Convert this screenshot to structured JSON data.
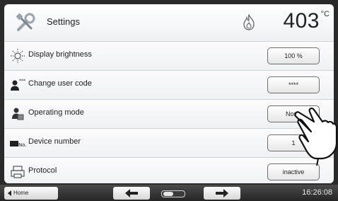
{
  "header": {
    "title": "Settings",
    "title_icon": "tools-icon",
    "temperature": "403",
    "temperature_unit": "°C",
    "status_icon": "flame-icon"
  },
  "rows": [
    {
      "label": "Display brightness",
      "value": "100 %",
      "icon": "sun-icon"
    },
    {
      "label": "Change user code",
      "value": "****",
      "icon": "user-code-icon"
    },
    {
      "label": "Operating mode",
      "value": "Norm",
      "icon": "operating-mode-icon"
    },
    {
      "label": "Device number",
      "value": "1",
      "icon": "device-number-icon"
    },
    {
      "label": "Protocol",
      "value": "inactive",
      "icon": "printer-icon"
    }
  ],
  "footer": {
    "home_label": "Home",
    "time": "16:26:08"
  },
  "colors": {
    "panel": "#f6f7f8",
    "footer": "#2d2d2d",
    "button_border": "#6e6e6e"
  }
}
